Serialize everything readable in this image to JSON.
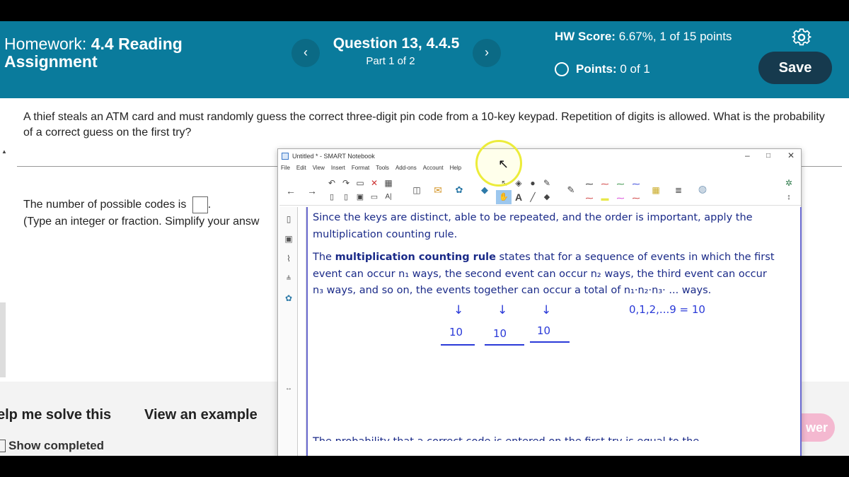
{
  "header": {
    "hw_prefix": "Homework:",
    "hw_name": "4.4 Reading Assignment",
    "question_title": "Question 13, 4.4.5",
    "question_part": "Part 1 of 2",
    "hw_score_label": "HW Score:",
    "hw_score_value": "6.67%, 1 of 15 points",
    "points_label": "Points:",
    "points_value": "0 of 1",
    "save_label": "Save",
    "prev_icon": "chevron-left-icon",
    "next_icon": "chevron-right-icon",
    "settings_icon": "gear-icon"
  },
  "question": {
    "text": "A thief steals an ATM card and must randomly guess the correct three-digit pin code from a 10-key keypad. Repetition of digits is allowed. What is the probability of a correct guess on the first try?",
    "answer_prompt": "The number of possible codes is",
    "answer_value": "",
    "answer_suffix": ".",
    "hint": "(Type an integer or fraction. Simplify your answ"
  },
  "bottom": {
    "help_label": "elp me solve this",
    "example_label": "View an example",
    "show_completed_label": "Show completed",
    "answer_label": "wer"
  },
  "notebook": {
    "title": "Untitled * - SMART Notebook",
    "menu": [
      "File",
      "Edit",
      "View",
      "Insert",
      "Format",
      "Tools",
      "Add-ons",
      "Account",
      "Help"
    ],
    "para1": "Since the keys are distinct, able to be repeated, and the order is important, apply the multiplication counting rule.",
    "para2_prefix": "The ",
    "para2_bold": "multiplication counting rule",
    "para2_rest": " states that for a sequence of events in which the first event can occur n₁ ways, the second event can occur n₂ ways, the third event can occur n₃ ways, and so on, the events together can occur a total of n₁·n₂·n₃· ... ways.",
    "handwriting": {
      "digits_note": "0,1,2,...9 = 10",
      "slot1": "10",
      "slot2": "10",
      "slot3": "10",
      "arrow": "↓"
    },
    "cut_line": "The probability that a correct code is entered on the first try is equal to the"
  },
  "colors": {
    "header_bg": "#0a7b9c",
    "save_bg": "#163a4e",
    "notebook_text": "#1a2a88",
    "handwriting": "#2a3ad8"
  }
}
